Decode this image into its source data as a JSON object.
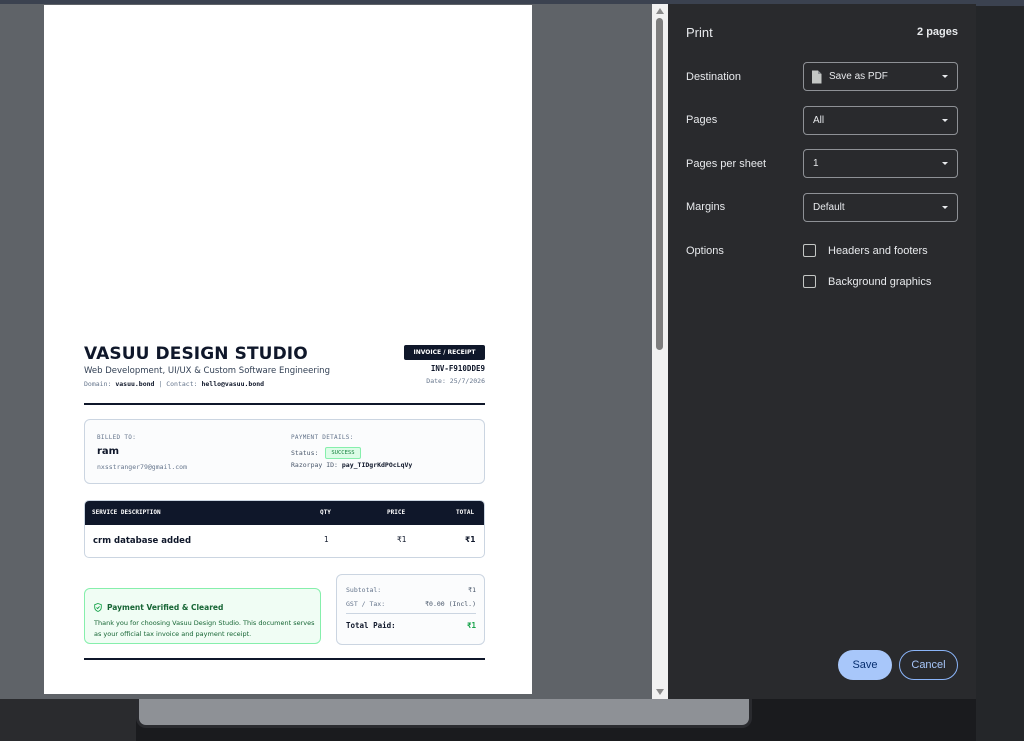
{
  "preview": {
    "invoice": {
      "studio_name": "VASUU DESIGN STUDIO",
      "tagline": "Web Development, UI/UX & Custom Software Engineering",
      "domain_label": "Domain:",
      "domain_value": "vasuu.bond",
      "contact_label": "| Contact:",
      "contact_value": "hello@vasuu.bond",
      "badge": "INVOICE / RECEIPT",
      "number": "INV-F910DDE9",
      "date": "Date: 25/7/2026",
      "billed_to_label": "BILLED TO:",
      "customer_name": "ram",
      "customer_email": "nxsstranger79@gmail.com",
      "payment_details_label": "PAYMENT DETAILS:",
      "status_label": "Status:",
      "status_value": "SUCCESS",
      "razorpay_label": "Razorpay ID:",
      "razorpay_value": "pay_TIDgrKdPOcLqVy",
      "table": {
        "headers": [
          "SERVICE DESCRIPTION",
          "QTY",
          "PRICE",
          "TOTAL"
        ],
        "rows": [
          {
            "description": "crm database added",
            "qty": "1",
            "price": "₹1",
            "total": "₹1"
          }
        ]
      },
      "verified_title": "Payment Verified & Cleared",
      "verified_message": "Thank you for choosing Vasuu Design Studio. This document serves as your official tax invoice and payment receipt.",
      "subtotal_label": "Subtotal:",
      "subtotal_value": "₹1",
      "tax_label": "GST / Tax:",
      "tax_value": "₹0.00 (Incl.)",
      "total_label": "Total Paid:",
      "total_value": "₹1"
    }
  },
  "panel": {
    "title": "Print",
    "page_count": "2 pages",
    "destination_label": "Destination",
    "destination_value": "Save as PDF",
    "pages_label": "Pages",
    "pages_value": "All",
    "pages_per_sheet_label": "Pages per sheet",
    "pages_per_sheet_value": "1",
    "margins_label": "Margins",
    "margins_value": "Default",
    "options_label": "Options",
    "option_headers_footers": "Headers and footers",
    "option_background_graphics": "Background graphics",
    "save_label": "Save",
    "cancel_label": "Cancel"
  },
  "colors": {
    "panel_bg": "#292a2d",
    "accent": "#a8c7fa",
    "invoice_dark": "#0f172a",
    "success_green": "#16a34a"
  },
  "icons": [
    "document-icon",
    "chevron-down-icon",
    "shield-check-icon",
    "scroll-up-arrow-icon",
    "scroll-down-arrow-icon"
  ]
}
